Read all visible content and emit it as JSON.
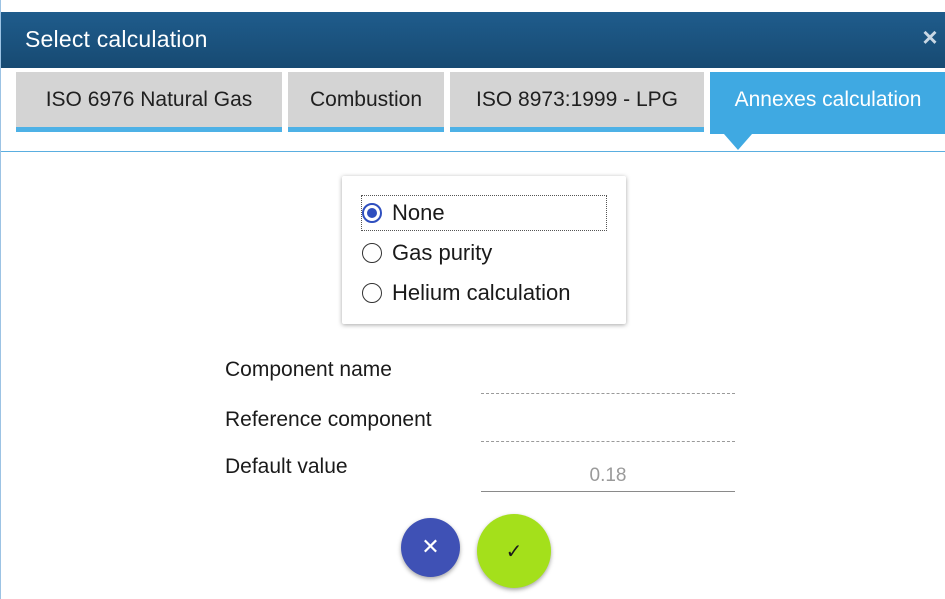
{
  "window": {
    "title": "Select calculation",
    "close_glyph": "×"
  },
  "tabs": [
    {
      "label": "ISO 6976 Natural Gas",
      "active": false
    },
    {
      "label": "Combustion",
      "active": false
    },
    {
      "label": "ISO 8973:1999 - LPG",
      "active": false
    },
    {
      "label": "Annexes calculation",
      "active": true
    }
  ],
  "calculation_options": {
    "selected": "None",
    "options": [
      {
        "label": "None",
        "checked": true
      },
      {
        "label": "Gas purity",
        "checked": false
      },
      {
        "label": "Helium calculation",
        "checked": false
      }
    ]
  },
  "fields": {
    "component_name": {
      "label": "Component name",
      "value": ""
    },
    "reference_component": {
      "label": "Reference component",
      "value": ""
    },
    "default_value": {
      "label": "Default value",
      "value": "0.18"
    }
  },
  "actions": {
    "cancel_glyph": "✕",
    "confirm_glyph": "✓"
  },
  "colors": {
    "title_bar": "#1f5c8c",
    "active_tab": "#3fa9e2",
    "tab_underline": "#4db1e6",
    "inactive_tab": "#d4d4d4",
    "radio_selected": "#2f4fbf",
    "cancel_button": "#3f51b5",
    "confirm_button": "#a4e01b"
  }
}
